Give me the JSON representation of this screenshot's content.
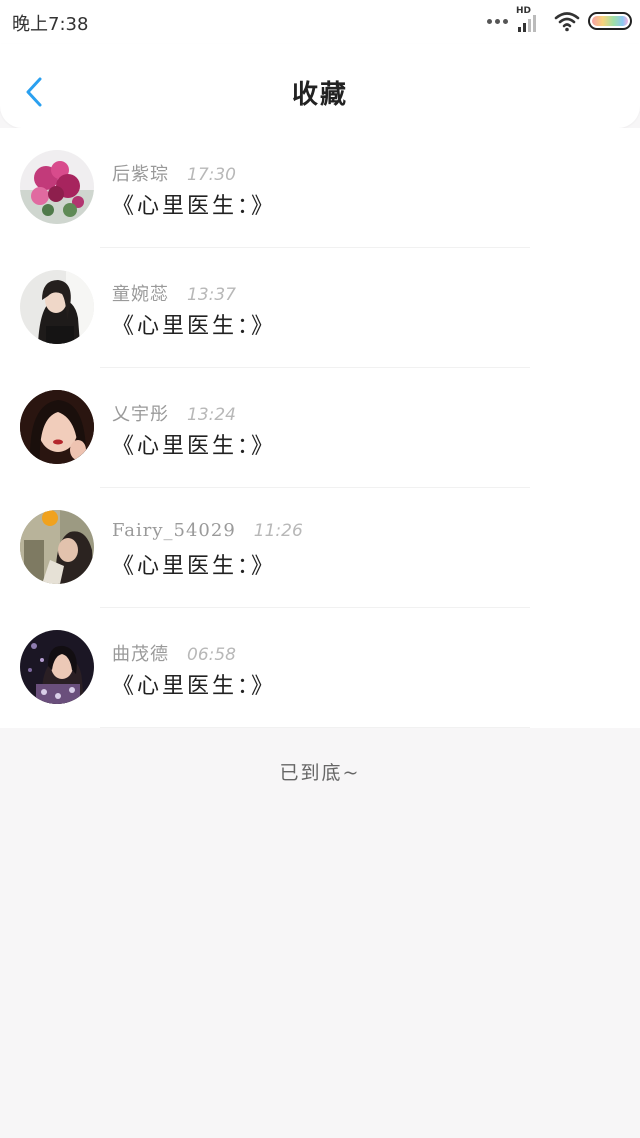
{
  "status_bar": {
    "time": "晚上7:38",
    "network_label": "HD",
    "battery_gradient": [
      "#f6a1a5",
      "#f8d27c",
      "#9fe0a6",
      "#8cc8f2",
      "#f3b3e4"
    ]
  },
  "header": {
    "title": "收藏",
    "back_icon": "chevron-left-icon",
    "accent_color": "#2aa0f0"
  },
  "favorites": [
    {
      "name": "后紫琮",
      "time": "17:30",
      "title": "《心里医生：》",
      "avatar": "flowers-photo"
    },
    {
      "name": "童婉蕊",
      "time": "13:37",
      "title": "《心里医生：》",
      "avatar": "woman-dark-hair-photo"
    },
    {
      "name": "乂宇彤",
      "time": "13:24",
      "title": "《心里医生：》",
      "avatar": "woman-portrait-photo"
    },
    {
      "name": "Fairy_54029",
      "time": "11:26",
      "title": "《心里医生：》",
      "avatar": "woman-outdoor-photo"
    },
    {
      "name": "曲茂德",
      "time": "06:58",
      "title": "《心里医生：》",
      "avatar": "woman-night-photo"
    }
  ],
  "footer": {
    "end_text": "已到底~"
  }
}
